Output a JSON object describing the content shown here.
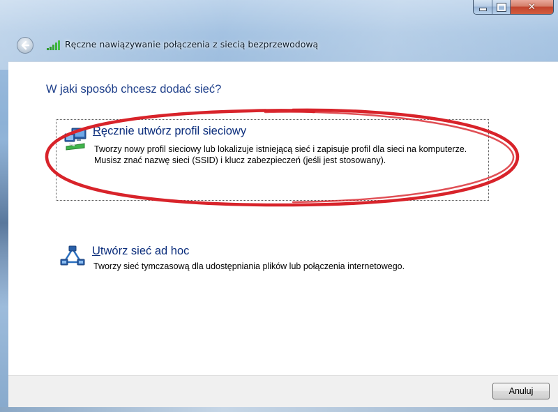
{
  "window": {
    "title": "Ręczne nawiązywanie połączenia z siecią bezprzewodową",
    "caption_buttons": {
      "minimize": "minimize-icon",
      "maximize": "maximize-icon",
      "close": "close-icon"
    }
  },
  "content": {
    "heading": "W jaki sposób chcesz dodać sieć?",
    "options": [
      {
        "accel": "R",
        "title_rest": "ęcznie utwórz profil sieciowy",
        "description": "Tworzy nowy profil sieciowy lub lokalizuje istniejącą sieć i zapisuje profil dla sieci na komputerze. Musisz znać nazwę sieci (SSID) i klucz zabezpieczeń (jeśli jest stosowany).",
        "icon": "network-profile-icon",
        "selected": true
      },
      {
        "accel": "U",
        "title_rest": "twórz sieć ad hoc",
        "description": "Tworzy sieć tymczasową dla  udostępniania plików lub połączenia internetowego.",
        "icon": "adhoc-network-icon",
        "selected": false
      }
    ]
  },
  "footer": {
    "cancel_label": "Anuluj"
  },
  "colors": {
    "heading": "#1e3f8a",
    "link_title": "#0c2e7c",
    "annotation": "#d8232a"
  }
}
